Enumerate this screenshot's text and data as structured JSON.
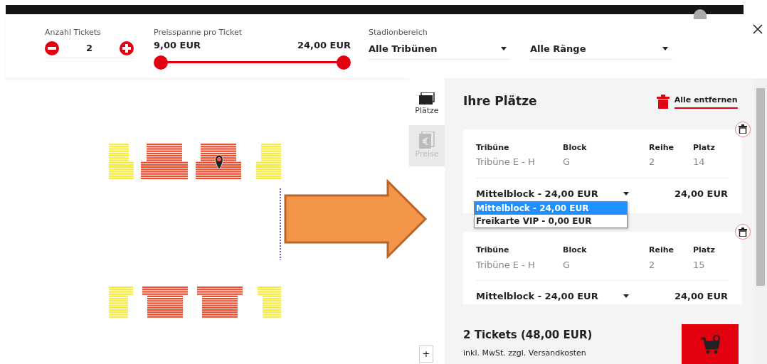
{
  "filters": {
    "tickets": {
      "label": "Anzahl Tickets",
      "value": "2"
    },
    "price_range": {
      "label": "Preisspanne pro Ticket",
      "min": "9,00 EUR",
      "max": "24,00 EUR",
      "thumbs": [
        {
          "level": 0
        },
        {
          "level": 1
        }
      ]
    },
    "stadium_area": {
      "label": "Stadionbereich",
      "value": "Alle Tribünen"
    },
    "tier": {
      "value": "Alle Ränge"
    }
  },
  "zoom": {
    "plus": "+"
  },
  "side_tabs": [
    {
      "label": "Plätze",
      "selected": true,
      "kind": "seats"
    },
    {
      "label": "Preise",
      "selected": false,
      "kind": "prices"
    }
  ],
  "panel": {
    "title": "Ihre Plätze",
    "remove_all": "Alle entfernen",
    "seats": [
      {
        "columns": [
          "Tribüne",
          "Block",
          "Reihe",
          "Platz"
        ],
        "values": [
          "Tribüne E - H",
          "G",
          "2",
          "14"
        ],
        "price_option": "Mittelblock - 24,00 EUR",
        "price": "24,00 EUR",
        "dropdown": [
          {
            "label": "Mittelblock - 24,00 EUR",
            "selected": true
          },
          {
            "label": "Freikarte VIP - 0,00 EUR",
            "selected": false
          }
        ]
      },
      {
        "columns": [
          "Tribüne",
          "Block",
          "Reihe",
          "Platz"
        ],
        "values": [
          "Tribüne E - H",
          "G",
          "2",
          "15"
        ],
        "price_option": "Mittelblock - 24,00 EUR",
        "price": "24,00 EUR"
      }
    ],
    "total": "2 Tickets (48,00 EUR)",
    "note": "inkl. MwSt. zzgl. Versandkosten"
  }
}
